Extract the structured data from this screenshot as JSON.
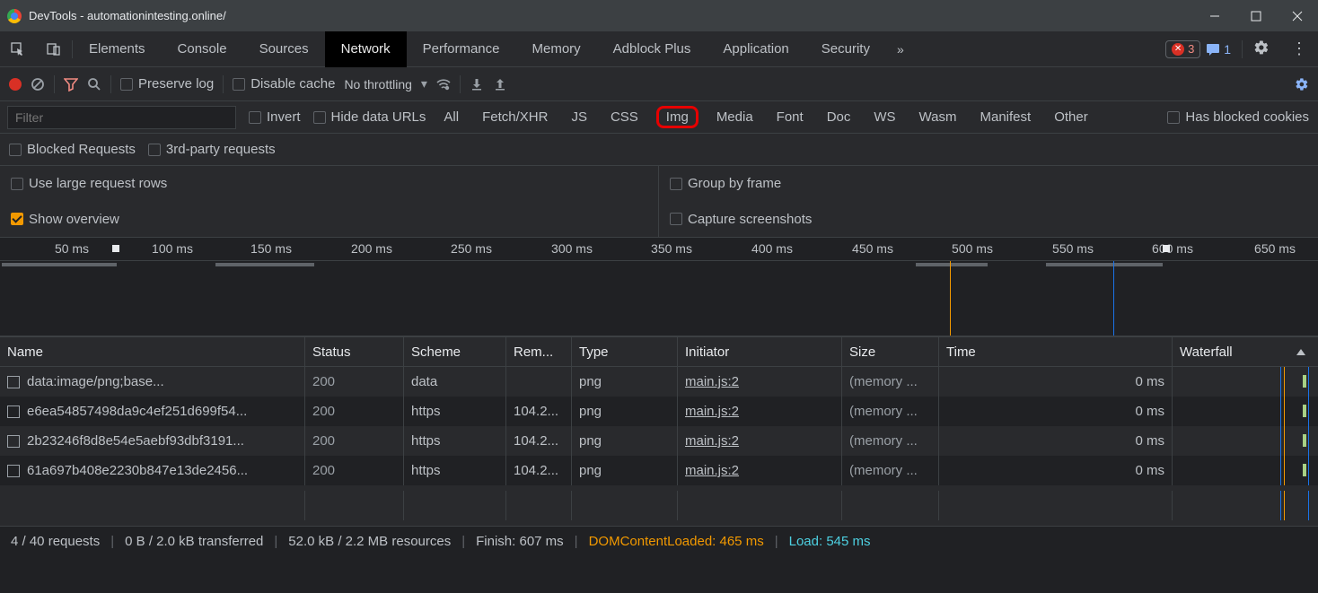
{
  "window": {
    "title": "DevTools - automationintesting.online/"
  },
  "tabs": {
    "items": [
      "Elements",
      "Console",
      "Sources",
      "Network",
      "Performance",
      "Memory",
      "Adblock Plus",
      "Application",
      "Security"
    ],
    "active": "Network",
    "errors": "3",
    "messages": "1"
  },
  "toolbar": {
    "preserve_log": "Preserve log",
    "disable_cache": "Disable cache",
    "throttling": "No throttling"
  },
  "filter": {
    "placeholder": "Filter",
    "invert": "Invert",
    "hide_data_urls": "Hide data URLs",
    "types": [
      "All",
      "Fetch/XHR",
      "JS",
      "CSS",
      "Img",
      "Media",
      "Font",
      "Doc",
      "WS",
      "Wasm",
      "Manifest",
      "Other"
    ],
    "selected_type": "Img",
    "has_blocked": "Has blocked cookies",
    "blocked_req": "Blocked Requests",
    "third_party": "3rd-party requests"
  },
  "options": {
    "large_rows": "Use large request rows",
    "group_frame": "Group by frame",
    "overview": "Show overview",
    "screenshots": "Capture screenshots"
  },
  "timeline": {
    "ticks": [
      "50 ms",
      "100 ms",
      "150 ms",
      "200 ms",
      "250 ms",
      "300 ms",
      "350 ms",
      "400 ms",
      "450 ms",
      "500 ms",
      "550 ms",
      "600 ms",
      "650 ms"
    ]
  },
  "grid": {
    "headers": {
      "name": "Name",
      "status": "Status",
      "scheme": "Scheme",
      "remote": "Rem...",
      "type": "Type",
      "initiator": "Initiator",
      "size": "Size",
      "time": "Time",
      "waterfall": "Waterfall"
    },
    "rows": [
      {
        "name": "data:image/png;base...",
        "status": "200",
        "scheme": "data",
        "remote": "",
        "type": "png",
        "initiator": "main.js:2",
        "size": "(memory ...",
        "time": "0 ms"
      },
      {
        "name": "e6ea54857498da9c4ef251d699f54...",
        "status": "200",
        "scheme": "https",
        "remote": "104.2...",
        "type": "png",
        "initiator": "main.js:2",
        "size": "(memory ...",
        "time": "0 ms"
      },
      {
        "name": "2b23246f8d8e54e5aebf93dbf3191...",
        "status": "200",
        "scheme": "https",
        "remote": "104.2...",
        "type": "png",
        "initiator": "main.js:2",
        "size": "(memory ...",
        "time": "0 ms"
      },
      {
        "name": "61a697b408e2230b847e13de2456...",
        "status": "200",
        "scheme": "https",
        "remote": "104.2...",
        "type": "png",
        "initiator": "main.js:2",
        "size": "(memory ...",
        "time": "0 ms"
      }
    ]
  },
  "footer": {
    "requests": "4 / 40 requests",
    "transferred": "0 B / 2.0 kB transferred",
    "resources": "52.0 kB / 2.2 MB resources",
    "finish": "Finish: 607 ms",
    "dom": "DOMContentLoaded: 465 ms",
    "load": "Load: 545 ms"
  }
}
